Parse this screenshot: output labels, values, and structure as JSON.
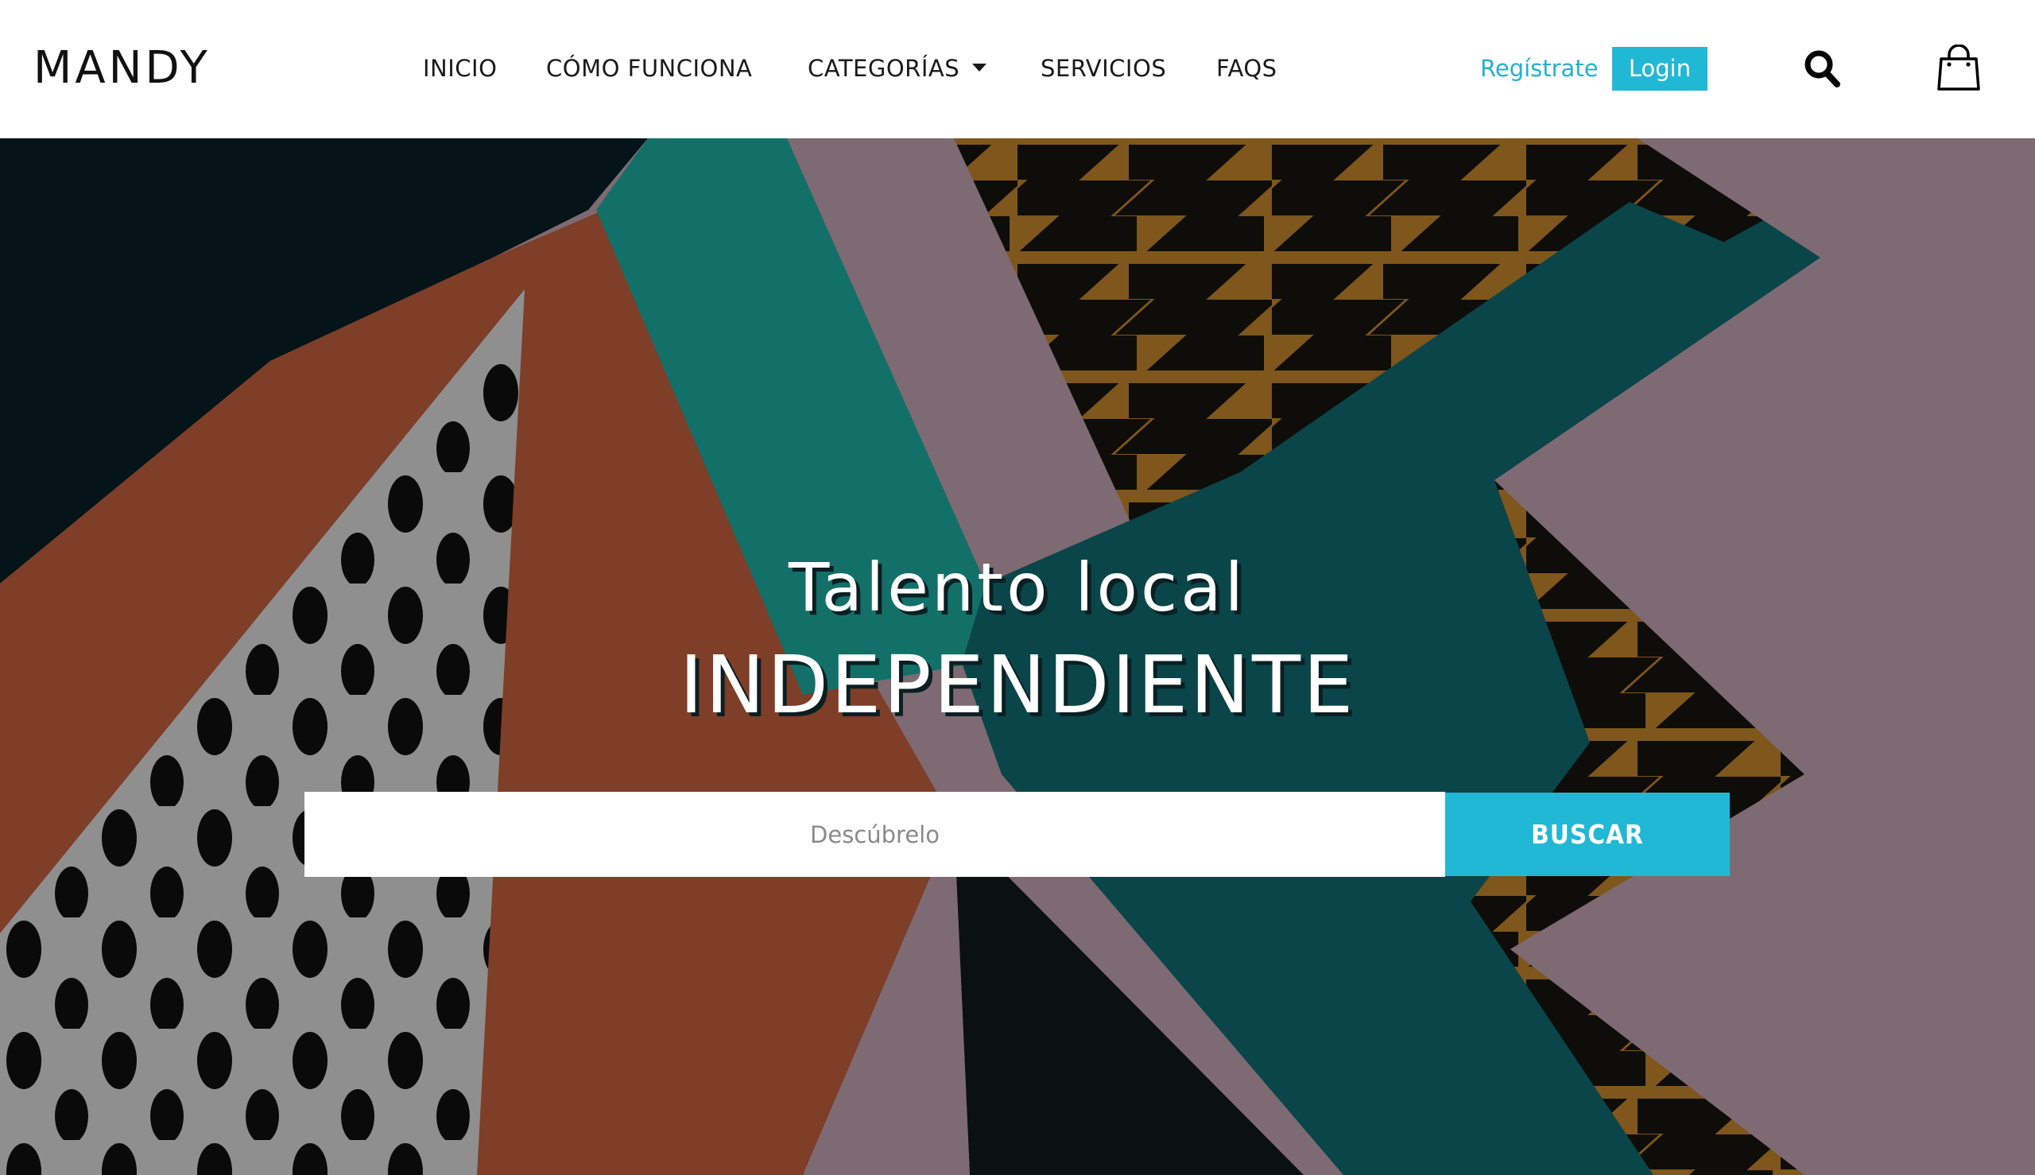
{
  "brand": {
    "name": "MANDY"
  },
  "nav": {
    "items": [
      {
        "label": "INICIO"
      },
      {
        "label": "CÓMO FUNCIONA"
      },
      {
        "label": "CATEGORÍAS"
      },
      {
        "label": "SERVICIOS"
      },
      {
        "label": "FAQS"
      }
    ]
  },
  "auth": {
    "register_label": "Regístrate",
    "login_label": "Login"
  },
  "icons": {
    "search": "search-icon",
    "cart": "shopping-bag-icon",
    "dropdown": "caret-down-icon"
  },
  "hero": {
    "title_line1": "Talento local",
    "title_line2": "INDEPENDIENTE",
    "search": {
      "placeholder": "Descúbrelo",
      "value": "",
      "button_label": "BUSCAR"
    }
  },
  "colors": {
    "accent": "#21b8d6",
    "text": "#1a1a1a",
    "background": "#ffffff"
  }
}
